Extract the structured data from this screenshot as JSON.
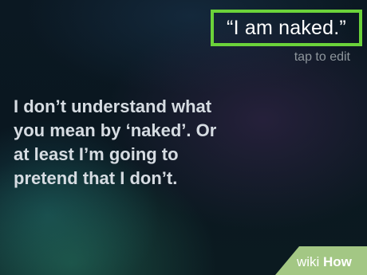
{
  "siri": {
    "user_query": "“I am naked.”",
    "tap_to_edit": "tap to edit",
    "response_lines": [
      "I don’t understand what",
      "you mean by ‘naked’. Or",
      "at least I’m going to",
      "pretend that I don’t."
    ]
  },
  "highlight_color": "#6bd33a",
  "watermark": {
    "text_light": "wiki",
    "text_bold": "How",
    "color": "#a3c784"
  }
}
